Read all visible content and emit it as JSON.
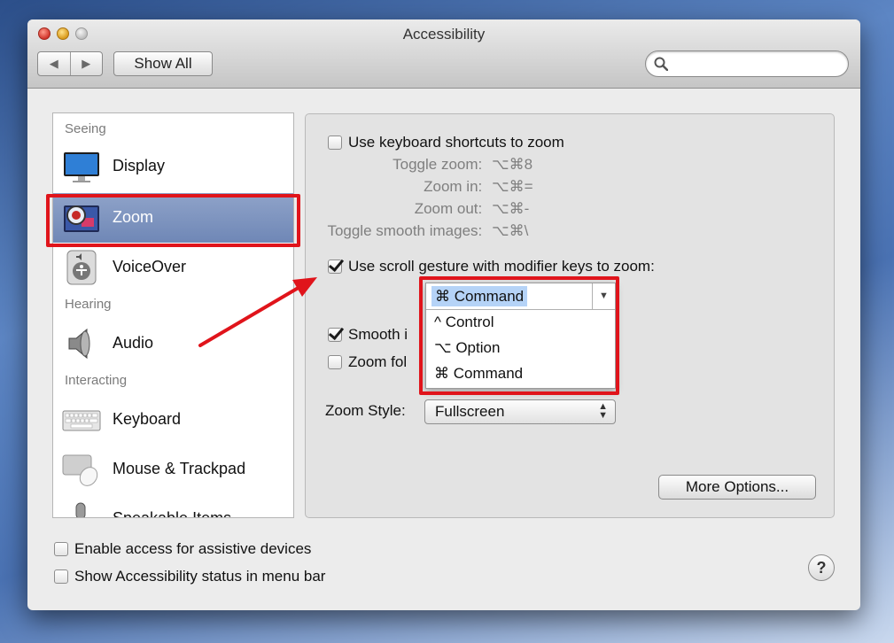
{
  "window": {
    "title": "Accessibility"
  },
  "toolbar": {
    "back_glyph": "◀",
    "forward_glyph": "▶",
    "show_all_label": "Show All",
    "search_placeholder": ""
  },
  "sidebar": {
    "headings": [
      "Seeing",
      "Hearing",
      "Interacting"
    ],
    "items": [
      {
        "label": "Display",
        "icon": "display-icon"
      },
      {
        "label": "Zoom",
        "icon": "zoom-icon",
        "selected": true
      },
      {
        "label": "VoiceOver",
        "icon": "voiceover-icon"
      },
      {
        "label": "Audio",
        "icon": "speaker-icon"
      },
      {
        "label": "Keyboard",
        "icon": "keyboard-icon"
      },
      {
        "label": "Mouse & Trackpad",
        "icon": "mouse-icon"
      },
      {
        "label": "Speakable Items",
        "icon": "microphone-icon"
      }
    ]
  },
  "zoom": {
    "keyboard_shortcuts": {
      "label": "Use keyboard shortcuts to zoom",
      "checked": false
    },
    "shortcuts": [
      {
        "label": "Toggle zoom:",
        "keys": "⌥⌘8"
      },
      {
        "label": "Zoom in:",
        "keys": "⌥⌘="
      },
      {
        "label": "Zoom out:",
        "keys": "⌥⌘-"
      },
      {
        "label": "Toggle smooth images:",
        "keys": "⌥⌘\\"
      }
    ],
    "scroll_gesture": {
      "label": "Use scroll gesture with modifier keys to zoom:",
      "checked": true
    },
    "modifier_dropdown": {
      "selected": "⌘ Command",
      "options": [
        "^ Control",
        "⌥ Option",
        "⌘ Command"
      ]
    },
    "smooth_images": {
      "label": "Smooth i",
      "checked": true
    },
    "zoom_follows": {
      "label": "Zoom fol",
      "checked": false
    },
    "zoom_style": {
      "label": "Zoom Style:",
      "value": "Fullscreen"
    },
    "more_options_label": "More Options..."
  },
  "footer": {
    "assistive": {
      "label": "Enable access for assistive devices",
      "checked": false
    },
    "status_menu": {
      "label": "Show Accessibility status in menu bar",
      "checked": false
    },
    "help_label": "?"
  },
  "colors": {
    "selection": "#7b90bf",
    "highlight_box": "#e0141b",
    "dropdown_highlight": "#b5d3f7"
  }
}
